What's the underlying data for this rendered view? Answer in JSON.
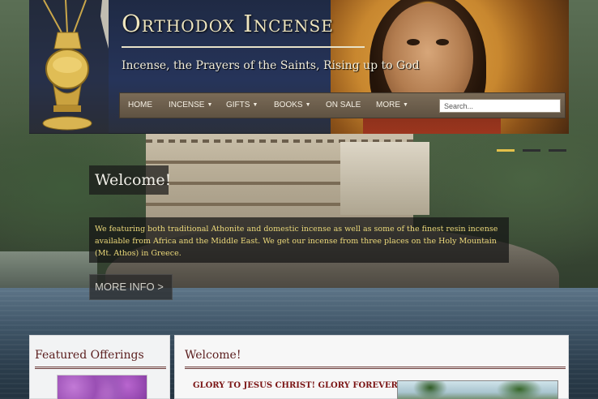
{
  "header": {
    "site_title": "Orthodox Incense",
    "tagline": "Incense, the Prayers of the Saints, Rising up to God"
  },
  "nav": {
    "items": [
      {
        "label": "HOME",
        "dropdown": false
      },
      {
        "label": "INCENSE",
        "dropdown": true
      },
      {
        "label": "GIFTS",
        "dropdown": true
      },
      {
        "label": "BOOKS",
        "dropdown": true
      },
      {
        "label": "ON SALE",
        "dropdown": false
      },
      {
        "label": "MORE",
        "dropdown": true
      }
    ],
    "search_placeholder": "Search..."
  },
  "hero": {
    "title": "Welcome!",
    "text": "We featuring both traditional Athonite and domestic incense as well as some of the finest resin incense available from Africa and the Middle East. We get our incense from three places on the Holy Mountain (Mt. Athos) in Greece.",
    "button_label": "MORE INFO >",
    "slides": 3,
    "active_slide": 1
  },
  "featured": {
    "heading": "Featured Offerings"
  },
  "welcome": {
    "heading": "Welcome!",
    "intro": "GLORY TO JESUS CHRIST!  GLORY FOREVER!"
  },
  "colors": {
    "nav_bg": "#6b5d4b",
    "heading_color": "#5a1d1d",
    "hero_text": "#ecd97a",
    "accent_gold": "#e3c04a"
  }
}
